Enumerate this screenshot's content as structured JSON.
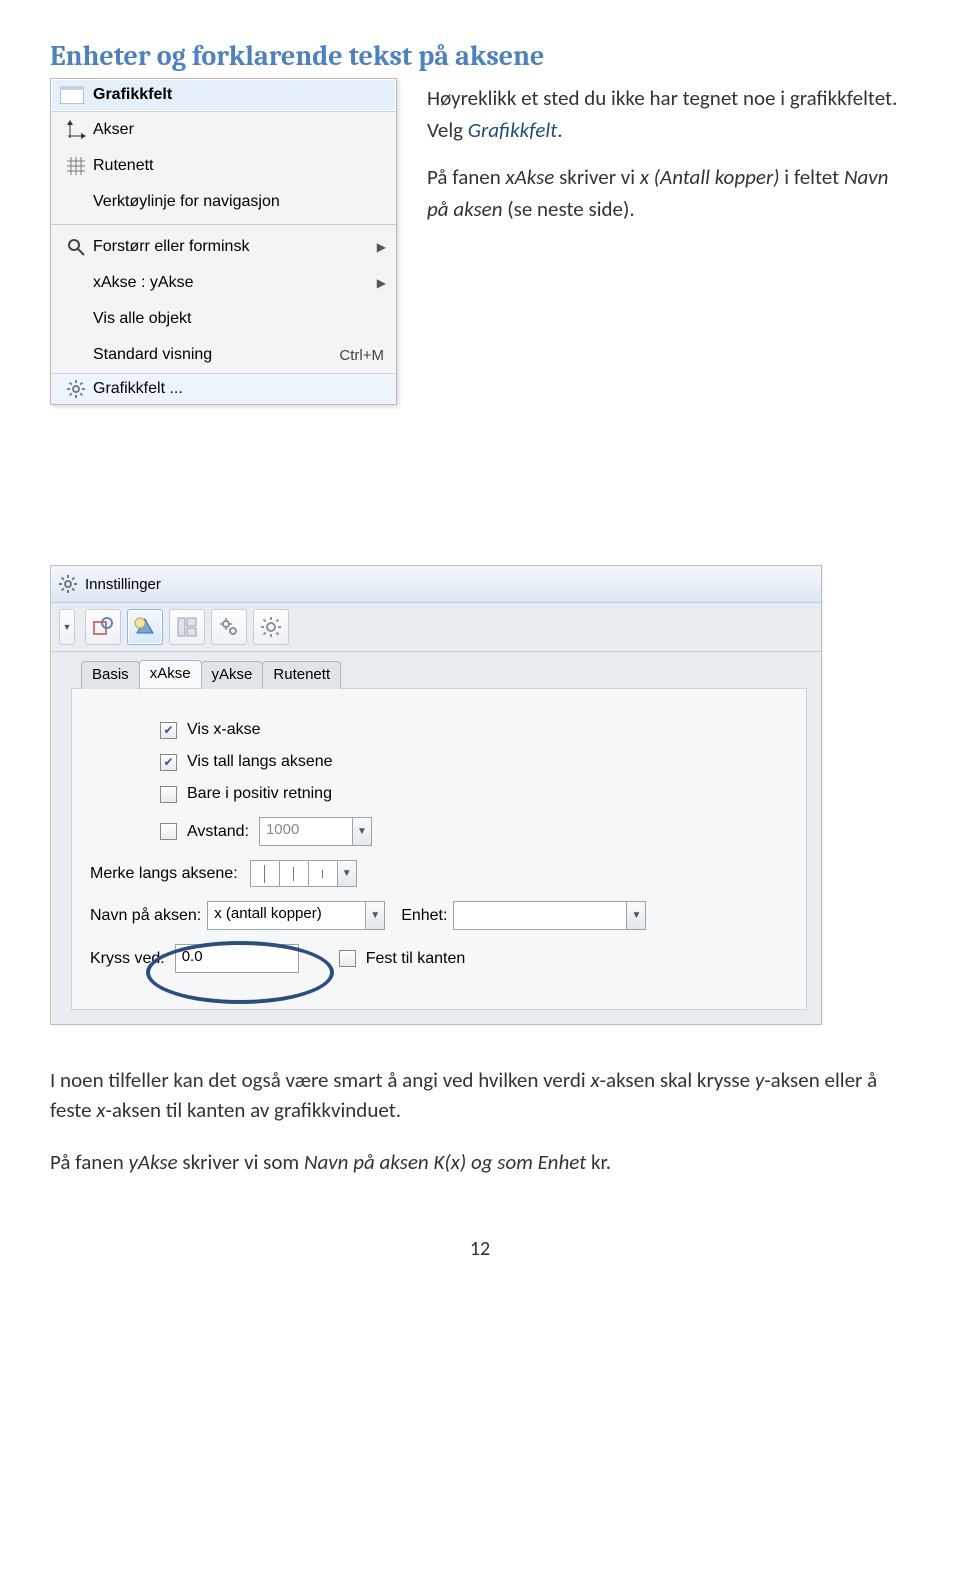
{
  "heading": "Enheter og forklarende tekst på aksene",
  "intro_para": "Høyreklikk et sted du ikke har tegnet noe i grafikkfeltet. Velg ",
  "intro_link": "Grafikkfelt",
  "intro_period": ".",
  "intro_para2_a": "På fanen ",
  "intro_para2_b": "xAkse",
  "intro_para2_c": " skriver vi ",
  "intro_para2_d": "x (Antall kopper)",
  "intro_para2_e": " i feltet ",
  "intro_para2_f": "Navn på aksen",
  "intro_para2_g": " (se neste side).",
  "ctx": {
    "header": "Grafikkfelt",
    "items": {
      "axes": "Akser",
      "grid": "Rutenett",
      "navbar": "Verktøylinje for navigasjon",
      "zoom": "Forstørr eller forminsk",
      "xyaxes": "xAkse : yAkse",
      "showall": "Vis alle objekt",
      "stdview": "Standard visning",
      "stdview_shortcut": "Ctrl+M",
      "footer": "Grafikkfelt ..."
    }
  },
  "dlg": {
    "title": "Innstillinger",
    "tabs": {
      "basis": "Basis",
      "xakse": "xAkse",
      "yakse": "yAkse",
      "rutenett": "Rutenett"
    },
    "chk_vis_x": "Vis x-akse",
    "chk_vis_tall": "Vis tall langs aksene",
    "chk_pos": "Bare i positiv retning",
    "chk_avstand": "Avstand:",
    "avstand_value": "1000",
    "merke_label": "Merke langs aksene:",
    "navn_label": "Navn på aksen:",
    "navn_value": "x (antall kopper)",
    "enhet_label": "Enhet:",
    "kryss_label": "Kryss ved:",
    "kryss_value": "0.0",
    "fest_label": "Fest til kanten"
  },
  "bottom_para_a": "I noen tilfeller kan det også være smart å angi ved hvilken verdi ",
  "bottom_para_b": "x",
  "bottom_para_c": "-aksen skal krysse ",
  "bottom_para_d": "y",
  "bottom_para_e": "-aksen eller å feste ",
  "bottom_para_f": "x",
  "bottom_para_g": "-aksen til kanten av grafikkvinduet.",
  "bottom_para2_a": "På fanen ",
  "bottom_para2_b": "yAkse",
  "bottom_para2_c": " skriver vi som ",
  "bottom_para2_d": "Navn på aksen",
  "bottom_para2_e": " K(",
  "bottom_para2_f": "x",
  "bottom_para2_g": ") og som ",
  "bottom_para2_h": "Enhet",
  "bottom_para2_i": " kr.",
  "page_num": "12"
}
